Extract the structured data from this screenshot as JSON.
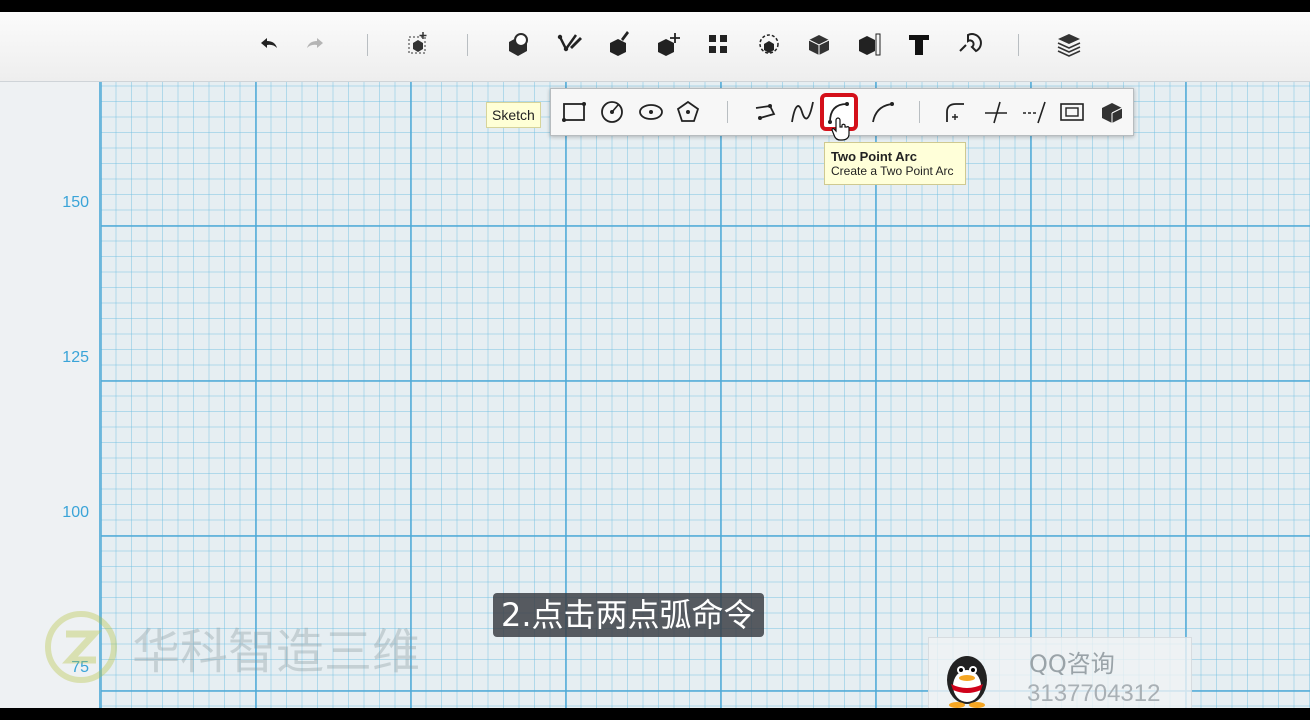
{
  "canvas": {
    "ruler_labels": [
      {
        "value": "150"
      },
      {
        "value": "125"
      },
      {
        "value": "100"
      },
      {
        "value": "75"
      }
    ]
  },
  "toolbar": {
    "icons": [
      "undo-icon",
      "redo-icon",
      "primitive-box-icon",
      "primitives-icon",
      "sketch-icon",
      "construct-icon",
      "modify-icon",
      "pattern-icon",
      "grouping-icon",
      "combine-icon",
      "measure-icon",
      "text-icon",
      "snap-icon",
      "material-icon"
    ]
  },
  "sketch_label": "Sketch",
  "tooltip": {
    "title": "Two Point Arc",
    "description": "Create a Two Point Arc"
  },
  "caption": "2.点击两点弧命令",
  "watermark": {
    "text": "华科智造三维"
  },
  "qq": {
    "label": "QQ咨询",
    "number": "3137704312"
  },
  "colors": {
    "grid_major": "#50aad7",
    "ruler_text": "#3aa4d8",
    "highlight": "#d4101a",
    "tooltip_bg": "#ffffd9"
  }
}
